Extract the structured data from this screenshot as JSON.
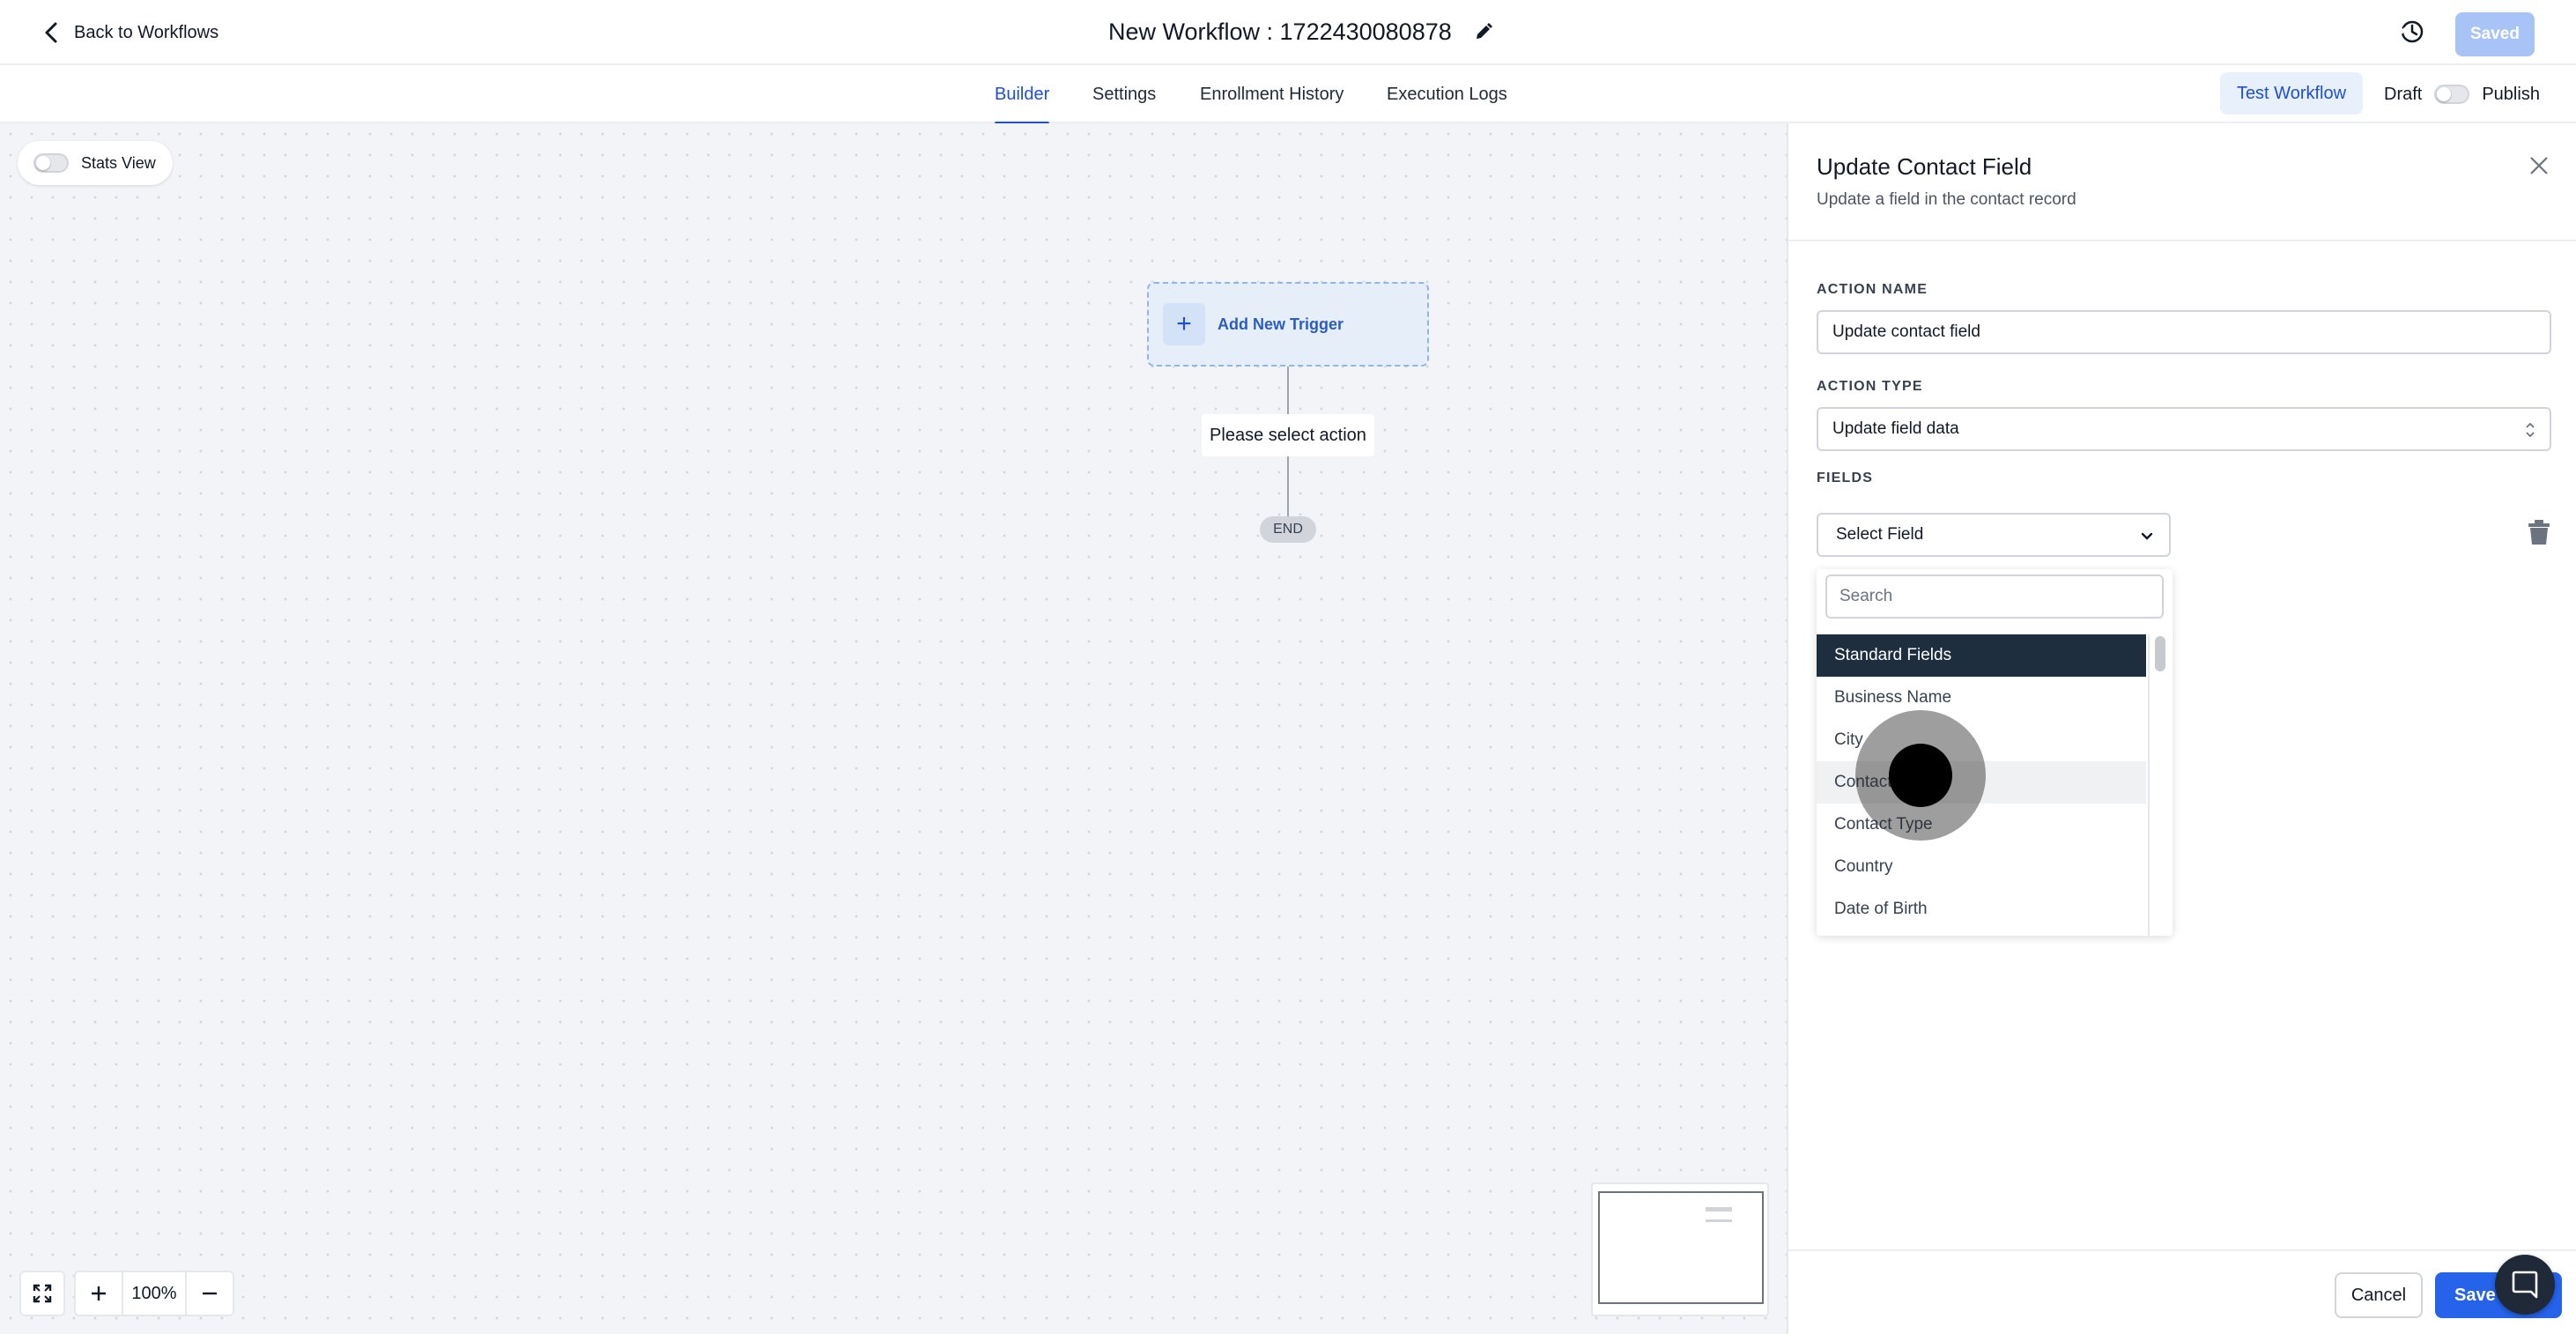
{
  "header": {
    "back_label": "Back to Workflows",
    "workflow_title": "New Workflow : 1722430080878",
    "saved_label": "Saved"
  },
  "tabs": [
    {
      "label": "Builder",
      "active": true
    },
    {
      "label": "Settings",
      "active": false
    },
    {
      "label": "Enrollment History",
      "active": false
    },
    {
      "label": "Execution Logs",
      "active": false
    }
  ],
  "actions": {
    "test_workflow": "Test Workflow",
    "draft_label": "Draft",
    "publish_label": "Publish"
  },
  "canvas": {
    "stats_view_label": "Stats View",
    "trigger_label": "Add New Trigger",
    "action_node_label": "Please select action",
    "end_label": "END",
    "zoom_level": "100%"
  },
  "panel": {
    "title": "Update Contact Field",
    "subtitle": "Update a field in the contact record",
    "action_name_label": "ACTION NAME",
    "action_name_value": "Update contact field",
    "action_type_label": "ACTION TYPE",
    "action_type_value": "Update field data",
    "fields_label": "FIELDS",
    "select_field_placeholder": "Select Field",
    "search_placeholder": "Search",
    "dropdown_items": [
      {
        "label": "Standard Fields",
        "type": "header"
      },
      {
        "label": "Business Name",
        "type": "option"
      },
      {
        "label": "City",
        "type": "option"
      },
      {
        "label": "Contact",
        "type": "option"
      },
      {
        "label": "Contact Type",
        "type": "option"
      },
      {
        "label": "Country",
        "type": "option"
      },
      {
        "label": "Date of Birth",
        "type": "option"
      }
    ],
    "cancel_label": "Cancel",
    "save_label": "Save A"
  },
  "colors": {
    "accent": "#1d4ed8",
    "primary_button": "#2563eb",
    "saved_button": "#a8c4f6",
    "dropdown_header": "#1f2e3f"
  }
}
